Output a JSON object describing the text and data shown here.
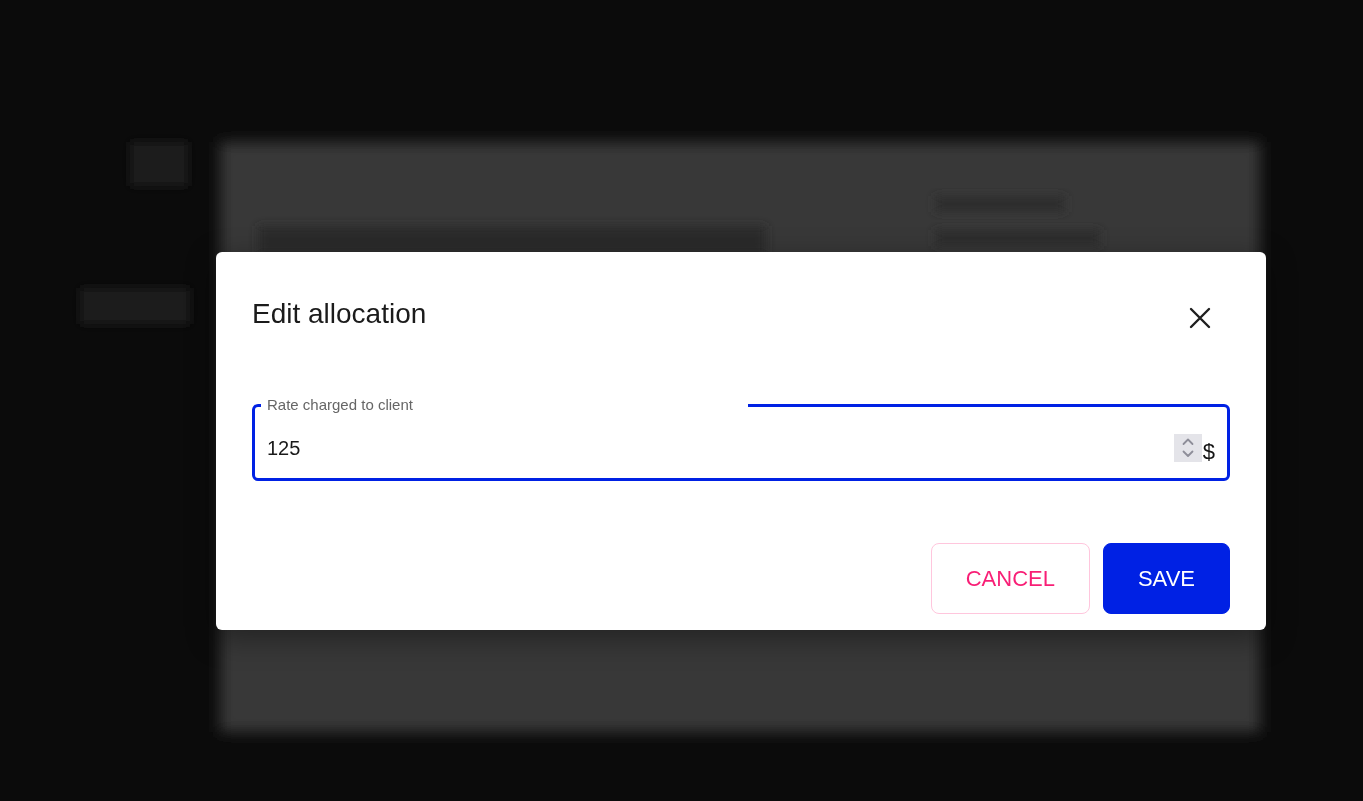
{
  "dialog": {
    "title": "Edit allocation",
    "field": {
      "label": "Rate charged to client",
      "value": "125",
      "suffix": "$",
      "focused": true
    },
    "buttons": [
      {
        "label": "CANCEL",
        "kind": "outlined"
      },
      {
        "label": "SAVE",
        "kind": "contained"
      }
    ]
  }
}
